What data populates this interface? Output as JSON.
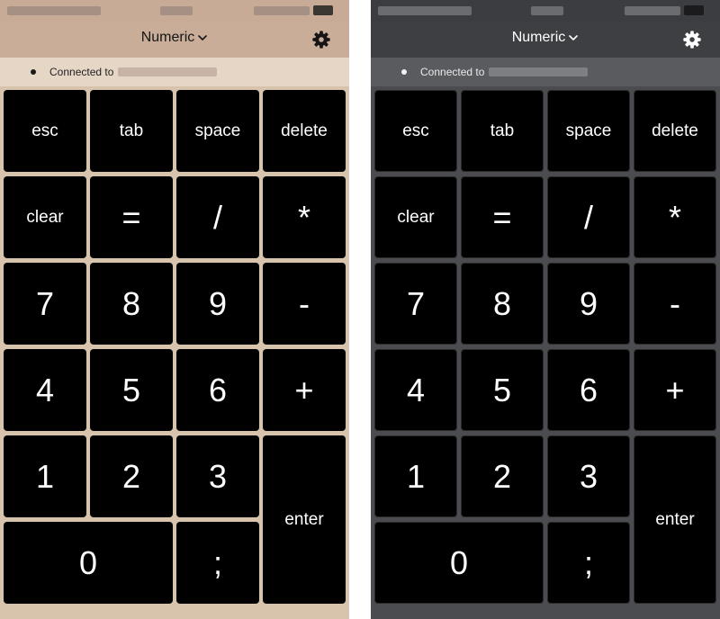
{
  "panels": [
    {
      "theme": "light",
      "mode_label": "Numeric",
      "connection_label": "Connected to",
      "colors": {
        "background": "#d8c3ad",
        "navbar": "#c9ad98",
        "connection_bar": "#e5d6c6",
        "key": "#000000",
        "key_text": "#ffffff"
      }
    },
    {
      "theme": "dark",
      "mode_label": "Numeric",
      "connection_label": "Connected to",
      "colors": {
        "background": "#4b4c50",
        "navbar": "#3e3f42",
        "connection_bar": "#5a5b5f",
        "key": "#000000",
        "key_text": "#ffffff"
      }
    }
  ],
  "icons": {
    "mode_dropdown": "chevron-down-icon",
    "settings": "gear-icon"
  },
  "keys": [
    {
      "id": "esc",
      "label": "esc"
    },
    {
      "id": "tab",
      "label": "tab"
    },
    {
      "id": "space",
      "label": "space"
    },
    {
      "id": "delete",
      "label": "delete"
    },
    {
      "id": "clear",
      "label": "clear"
    },
    {
      "id": "equals",
      "label": "="
    },
    {
      "id": "slash",
      "label": "/"
    },
    {
      "id": "asterisk",
      "label": "*"
    },
    {
      "id": "7",
      "label": "7"
    },
    {
      "id": "8",
      "label": "8"
    },
    {
      "id": "9",
      "label": "9"
    },
    {
      "id": "minus",
      "label": "-"
    },
    {
      "id": "4",
      "label": "4"
    },
    {
      "id": "5",
      "label": "5"
    },
    {
      "id": "6",
      "label": "6"
    },
    {
      "id": "plus",
      "label": "+"
    },
    {
      "id": "1",
      "label": "1"
    },
    {
      "id": "2",
      "label": "2"
    },
    {
      "id": "3",
      "label": "3"
    },
    {
      "id": "enter",
      "label": "enter"
    },
    {
      "id": "0",
      "label": "0"
    },
    {
      "id": "semicolon",
      "label": ";"
    }
  ]
}
